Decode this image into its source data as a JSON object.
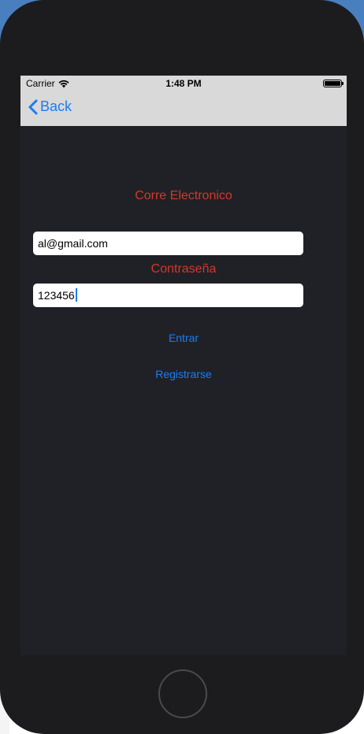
{
  "status_bar": {
    "carrier": "Carrier",
    "time": "1:48 PM",
    "wifi_icon": "wifi-icon",
    "battery_icon": "battery-icon"
  },
  "nav_bar": {
    "back_label": "Back",
    "back_icon": "chevron-left-icon"
  },
  "form": {
    "email_label": "Corre Electronico",
    "email_value": "al@gmail.com",
    "password_label": "Contraseña",
    "password_value": "123456",
    "enter_label": "Entrar",
    "register_label": "Registrarse"
  },
  "colors": {
    "label_red": "#d4372b",
    "link_blue": "#1a7cf2",
    "screen_background": "#202126",
    "bar_background": "#d9d9d9"
  }
}
